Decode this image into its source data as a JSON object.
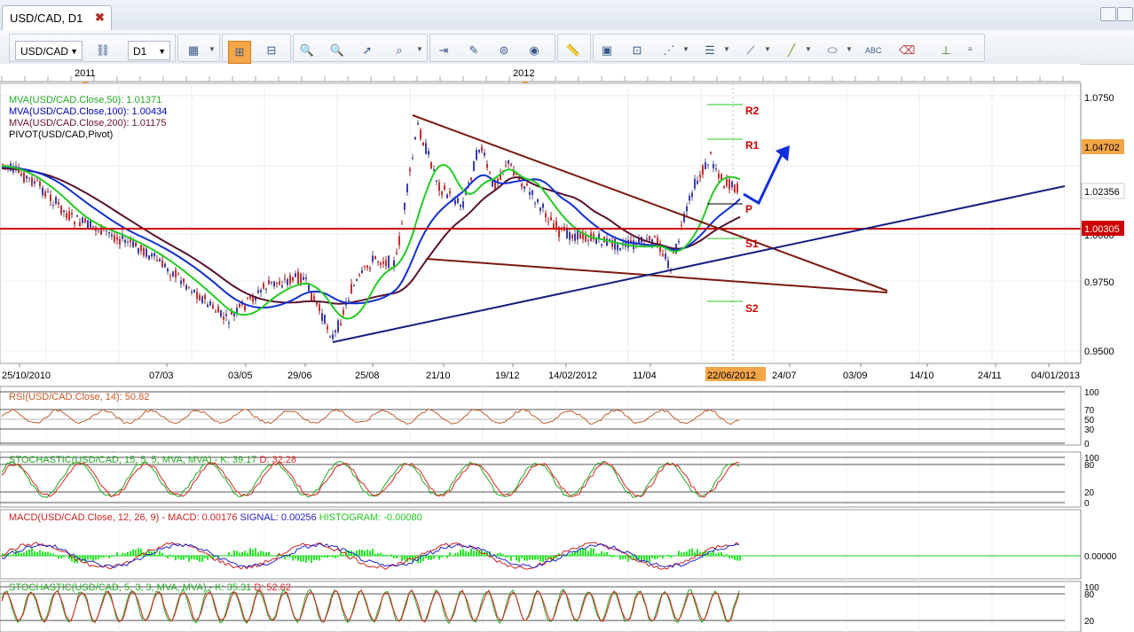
{
  "window": {
    "tab_title": "USD/CAD, D1",
    "close": "✖"
  },
  "toolbar": {
    "symbol": "USD/CAD",
    "timeframe": "D1",
    "link_icon": "link-icon"
  },
  "top_axis": {
    "labels": [
      "2011",
      "2012"
    ]
  },
  "main": {
    "legend": [
      {
        "text": "MVA(USD/CAD.Close,50): 1.01371",
        "color": "#00c000"
      },
      {
        "text": "MVA(USD/CAD.Close,100): 1.00434",
        "color": "#0000c0"
      },
      {
        "text": "MVA(USD/CAD.Close,200): 1.01175",
        "color": "#6a1030"
      },
      {
        "text": "PIVOT(USD/CAD,Pivot)",
        "color": "#000000"
      }
    ],
    "price_ticks": [
      "1.0750",
      "1.0500",
      "1.0000",
      "0.9750",
      "0.9500"
    ],
    "price_badges": {
      "current": "1.04702",
      "p1": "1.02356",
      "p2": "1.00305"
    },
    "pivot_labels": {
      "r2": "R2",
      "r1": "R1",
      "p": "P",
      "s1": "S1",
      "s2": "S2"
    },
    "date_ticks": [
      "25/10/2010",
      "07/03",
      "03/05",
      "29/06",
      "25/08",
      "21/10",
      "19/12",
      "14/02/2012",
      "11/04",
      "24/07",
      "03/09",
      "14/10",
      "24/11",
      "04/01/2013"
    ],
    "date_badge": "22/06/2012"
  },
  "rsi": {
    "label": "RSI(USD/CAD.Close, 14): 50.82",
    "ticks": [
      "100",
      "70",
      "50",
      "30",
      "0"
    ]
  },
  "stoch1": {
    "prefix": "STOCHASTIC(USD/CAD, 15, 5, 5, MVA, MVA) -",
    "k": "K: 39.17",
    "d": "D: 32.28",
    "ticks": [
      "100",
      "80",
      "20",
      "0"
    ]
  },
  "macd": {
    "prefix": "MACD(USD/CAD.Close, 12, 26, 9) -",
    "macd": "MACD: 0.00176",
    "signal": "SIGNAL: 0.00256",
    "hist": "HISTOGRAM: -0.00080",
    "ticks": [
      "0.00000"
    ]
  },
  "stoch2": {
    "prefix": "STOCHASTIC(USD/CAD, 5, 3, 3, MVA, MVA) -",
    "k": "K: 35.31",
    "d": "D: 52.62",
    "ticks": [
      "100",
      "80",
      "20"
    ]
  },
  "colors": {
    "accent": "#f5a649",
    "pivot_red": "#cc0000",
    "trend_brown": "#7a1a10",
    "trend_blue": "#101e80",
    "ma50": "#22cc22",
    "ma100": "#1030d0",
    "ma200": "#5a1030"
  }
}
